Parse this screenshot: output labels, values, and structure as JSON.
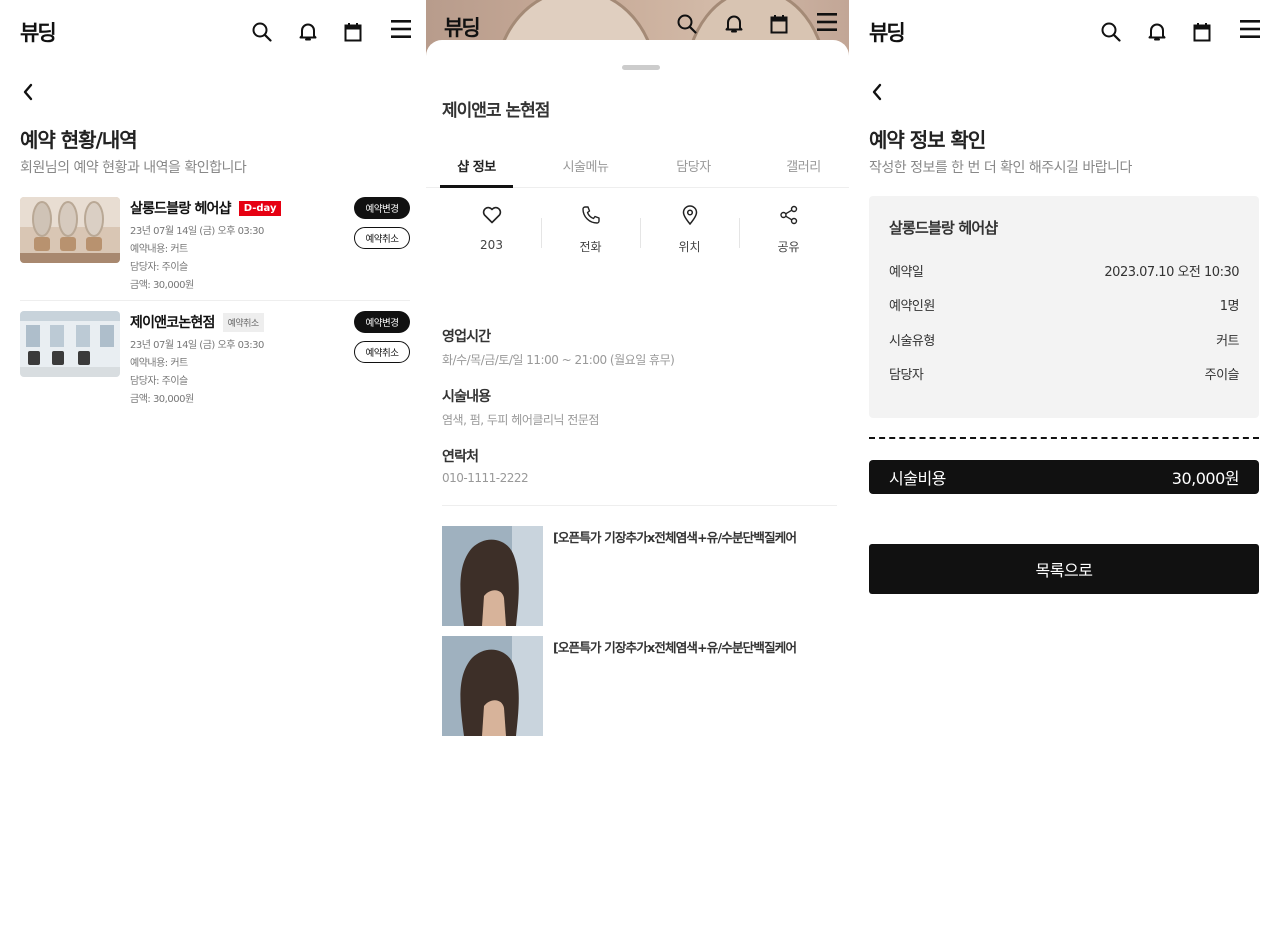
{
  "header": {
    "logo": "뷰딩"
  },
  "list_page": {
    "title": "예약 현황/내역",
    "subtitle": "회원님의 예약 현황과 내역을 확인합니다",
    "bookings": [
      {
        "shop": "살롱드블랑 헤어샵",
        "badge": "D-day",
        "date": "23년 07월 14일 (금) 오후 03:30",
        "content": "예약내용: 커트",
        "staff": "담당자: 주이슬",
        "price": "금액: 30,000원",
        "change_label": "예약변경",
        "cancel_label": "예약취소"
      },
      {
        "shop": "제이앤코논현점",
        "badge": "예약취소",
        "date": "23년 07월 14일 (금) 오후 03:30",
        "content": "예약내용: 커트",
        "staff": "담당자: 주이슬",
        "price": "금액: 30,000원",
        "change_label": "예약변경",
        "cancel_label": "예약취소"
      }
    ]
  },
  "shop_page": {
    "name": "제이앤코 논현점",
    "tabs": [
      "샵 정보",
      "시술메뉴",
      "담당자",
      "갤러리"
    ],
    "actions": [
      {
        "icon": "heart-icon",
        "label": "203"
      },
      {
        "icon": "phone-icon",
        "label": "전화"
      },
      {
        "icon": "location-pin-icon",
        "label": "위치"
      },
      {
        "icon": "share-icon",
        "label": "공유"
      }
    ],
    "hours_title": "영업시간",
    "hours_value": "화/수/목/금/토/일 11:00 ~ 21:00 (월요일 휴무)",
    "services_title": "시술내용",
    "services_value": "염색, 펌, 두피 헤어클리닉 전문점",
    "contact_title": "연락처",
    "contact_value": "010-1111-2222",
    "products": [
      {
        "title": "[오픈특가 기장추가x전체염색+유/수분단백질케어"
      },
      {
        "title": "[오픈특가 기장추가x전체염색+유/수분단백질케어"
      }
    ]
  },
  "confirm_page": {
    "title": "예약 정보 확인",
    "subtitle": "작성한 정보를 한 번 더 확인 해주시길 바랍니다",
    "shop": "살롱드블랑 헤어샵",
    "rows": [
      {
        "label": "예약일",
        "value": "2023.07.10 오전 10:30"
      },
      {
        "label": "예약인원",
        "value": "1명"
      },
      {
        "label": "시술유형",
        "value": "커트"
      },
      {
        "label": "담당자",
        "value": "주이슬"
      }
    ],
    "cost_label": "시술비용",
    "cost_value": "30,000원",
    "list_button": "목록으로"
  },
  "colors": {
    "accent": "#111111",
    "dday": "#e60012",
    "card_bg": "#f3f3f3"
  }
}
